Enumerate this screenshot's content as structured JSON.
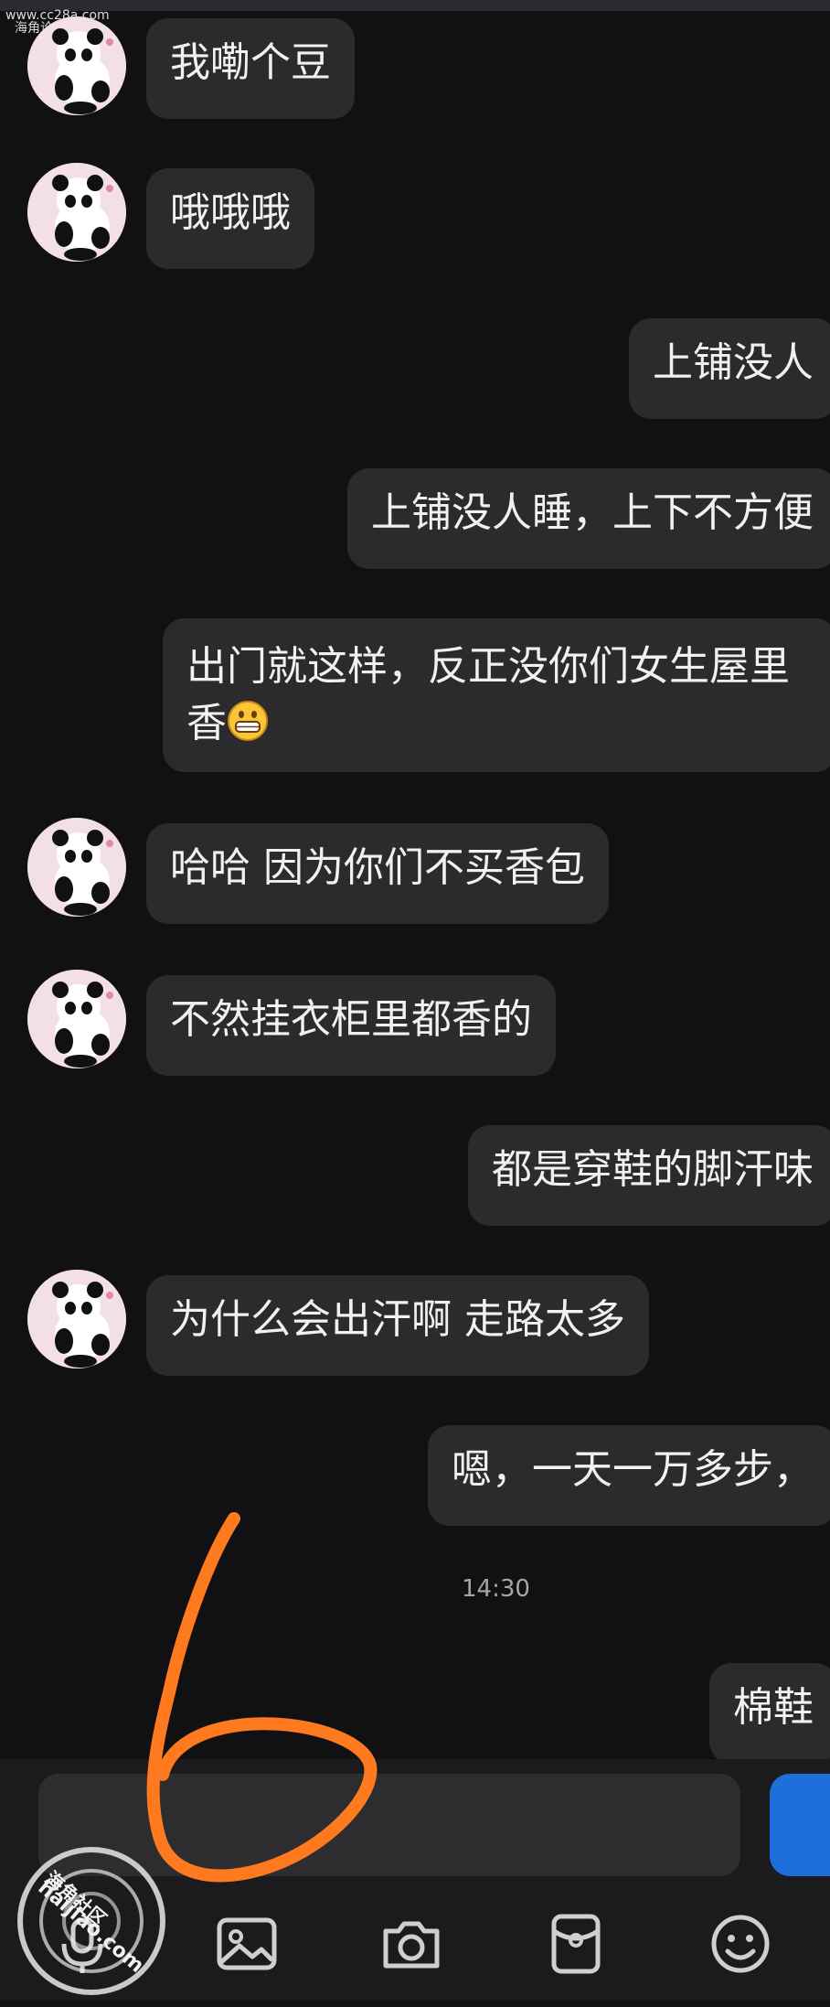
{
  "watermark_top": {
    "line1": "www.cc28a.com",
    "line2": "海角论坛"
  },
  "messages": [
    {
      "side": "left",
      "text": "我嘞个豆"
    },
    {
      "side": "left",
      "text": "哦哦哦"
    },
    {
      "side": "right",
      "text": "上铺没人"
    },
    {
      "side": "right",
      "text": "上铺没人睡，上下不方便"
    },
    {
      "side": "right",
      "line1": "出门就这样，反正没你们女生屋里",
      "line2": "香",
      "emoji": "grinning-face-emoji"
    },
    {
      "side": "left",
      "text": "哈哈 因为你们不买香包"
    },
    {
      "side": "left",
      "text": "不然挂衣柜里都香的"
    },
    {
      "side": "right",
      "text": "都是穿鞋的脚汗味"
    },
    {
      "side": "left",
      "text": "为什么会出汗啊 走路太多"
    },
    {
      "side": "right",
      "text": "嗯，一天一万多步，"
    },
    {
      "side": "right",
      "text": "棉鞋"
    }
  ],
  "timestamp": "14:30",
  "input": {
    "value": "",
    "placeholder": ""
  },
  "toolbar": {
    "icons": [
      "microphone-icon",
      "image-icon",
      "camera-icon",
      "red-packet-icon",
      "emoji-icon"
    ]
  },
  "watermark_stamp": {
    "line1": "海角社区",
    "line2": "haijiao.com"
  },
  "colors": {
    "background": "#111113",
    "bubble": "#2b2b2e",
    "send": "#1e6fd9",
    "scribble": "#ff7a1f"
  }
}
